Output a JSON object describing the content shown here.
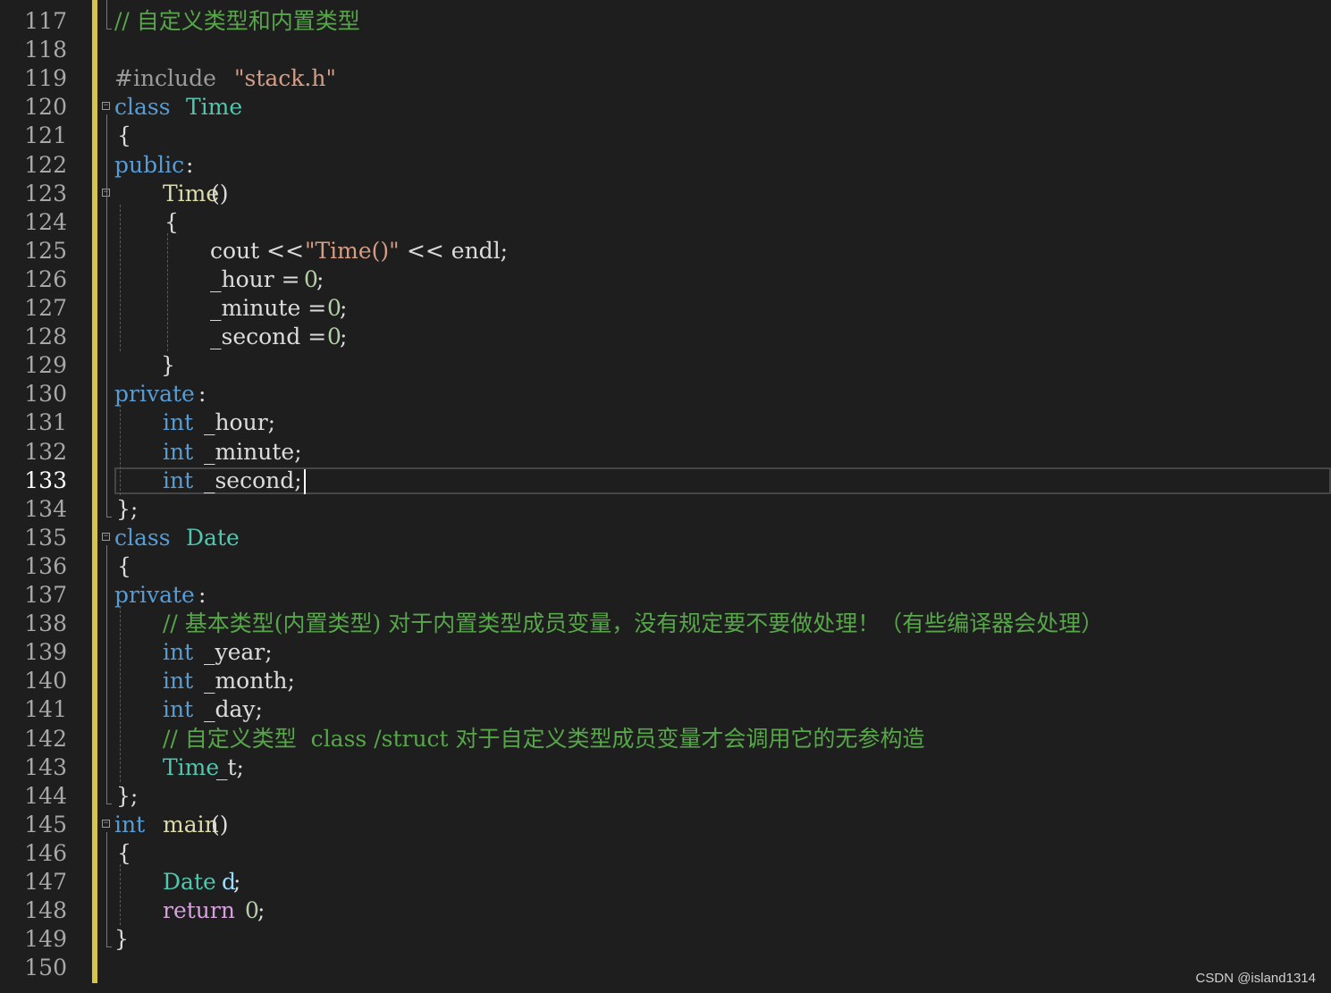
{
  "editor": {
    "current_line": "133",
    "lines": [
      {
        "n": "117",
        "text": "// 自定义类型和内置类型"
      },
      {
        "n": "118",
        "text": ""
      },
      {
        "n": "119",
        "text": "#include \"stack.h\""
      },
      {
        "n": "120",
        "text": "class Time"
      },
      {
        "n": "121",
        "text": "{"
      },
      {
        "n": "122",
        "text": "public:"
      },
      {
        "n": "123",
        "text": "Time()"
      },
      {
        "n": "124",
        "text": "{"
      },
      {
        "n": "125",
        "text": "cout << \"Time()\" << endl;"
      },
      {
        "n": "126",
        "text": "_hour = 0;"
      },
      {
        "n": "127",
        "text": "_minute = 0;"
      },
      {
        "n": "128",
        "text": "_second = 0;"
      },
      {
        "n": "129",
        "text": "}"
      },
      {
        "n": "130",
        "text": "private:"
      },
      {
        "n": "131",
        "text": "int _hour;"
      },
      {
        "n": "132",
        "text": "int _minute;"
      },
      {
        "n": "133",
        "text": "int _second;"
      },
      {
        "n": "134",
        "text": "};"
      },
      {
        "n": "135",
        "text": "class Date"
      },
      {
        "n": "136",
        "text": "{"
      },
      {
        "n": "137",
        "text": "private:"
      },
      {
        "n": "138",
        "text": "// 基本类型(内置类型) 对于内置类型成员变量，没有规定要不要做处理！（有些编译器会处理）"
      },
      {
        "n": "139",
        "text": "int _year;"
      },
      {
        "n": "140",
        "text": "int _month;"
      },
      {
        "n": "141",
        "text": "int _day;"
      },
      {
        "n": "142",
        "text": "// 自定义类型  class /struct 对于自定义类型成员变量才会调用它的无参构造"
      },
      {
        "n": "143",
        "text": "Time _t;"
      },
      {
        "n": "144",
        "text": "};"
      },
      {
        "n": "145",
        "text": "int main()"
      },
      {
        "n": "146",
        "text": "{"
      },
      {
        "n": "147",
        "text": "Date d;"
      },
      {
        "n": "148",
        "text": "return 0;"
      },
      {
        "n": "149",
        "text": "}"
      },
      {
        "n": "150",
        "text": ""
      }
    ]
  },
  "tokens": {
    "l117_cm": "// 自定义类型和内置类型",
    "l119_pp": "#include ",
    "l119_str": "\"stack.h\"",
    "l120_kw": "class",
    "l120_type": "Time",
    "l121": "{",
    "l122_kw": "public",
    "l122_p": ":",
    "l123_fn": "Time",
    "l123_p": "()",
    "l124": "{",
    "l125_a": "cout << ",
    "l125_str": "\"Time()\"",
    "l125_b": " << endl;",
    "l126_a": "_hour = ",
    "l126_num": "0",
    "l126_b": ";",
    "l127_a": "_minute = ",
    "l127_num": "0",
    "l127_b": ";",
    "l128_a": "_second = ",
    "l128_num": "0",
    "l128_b": ";",
    "l129": "}",
    "l130_kw": "private",
    "l130_p": ":",
    "l131_kw": "int",
    "l131_a": " _hour;",
    "l132_kw": "int",
    "l132_a": " _minute;",
    "l133_kw": "int",
    "l133_a": " _second;",
    "l134": "};",
    "l135_kw": "class",
    "l135_type": "Date",
    "l136": "{",
    "l137_kw": "private",
    "l137_p": ":",
    "l138_cm": "// 基本类型(内置类型) 对于内置类型成员变量，没有规定要不要做处理！（有些编译器会处理）",
    "l139_kw": "int",
    "l139_a": " _year;",
    "l140_kw": "int",
    "l140_a": " _month;",
    "l141_kw": "int",
    "l141_a": " _day;",
    "l142_cm": "// 自定义类型  class /struct 对于自定义类型成员变量才会调用它的无参构造",
    "l143_type": "Time",
    "l143_a": " _t;",
    "l144": "};",
    "l145_kw": "int",
    "l145_fn": "main",
    "l145_p": "()",
    "l146": "{",
    "l147_type": "Date",
    "l147_a": "d",
    "l147_b": ";",
    "l148_ctl": "return",
    "l148_num": "0",
    "l148_b": ";",
    "l149": "}"
  },
  "watermark": "CSDN @island1314",
  "colors": {
    "background": "#1e1e1e",
    "keyword": "#569cd6",
    "type": "#4ec9b0",
    "function": "#dcdcaa",
    "string": "#d69d85",
    "comment": "#57a64a",
    "number": "#b5cea8",
    "control": "#d8a0df",
    "change_bar": "#d7c54a"
  }
}
